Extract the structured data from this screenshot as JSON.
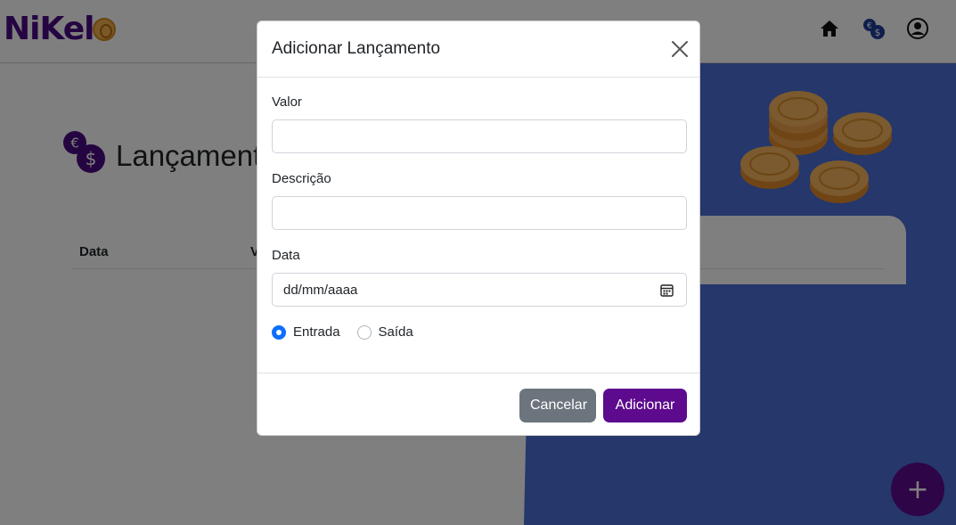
{
  "app": {
    "logo_text": "NiKel",
    "nav_icons": [
      "home-icon",
      "currency-exchange-icon",
      "user-profile-icon"
    ]
  },
  "page": {
    "title": "Lançamentos",
    "table_headers": [
      "Data",
      "Valor"
    ],
    "fab_label": "+"
  },
  "modal": {
    "title": "Adicionar Lançamento",
    "fields": {
      "valor_label": "Valor",
      "valor_value": "",
      "descricao_label": "Descrição",
      "descricao_value": "",
      "data_label": "Data",
      "data_placeholder": "dd/mm/aaaa"
    },
    "radios": [
      {
        "label": "Entrada",
        "checked": true
      },
      {
        "label": "Saída",
        "checked": false
      }
    ],
    "buttons": {
      "cancel": "Cancelar",
      "add": "Adicionar"
    }
  },
  "colors": {
    "brand_purple": "#5d0a8e",
    "blue_background": "#4a6fd6",
    "radio_checked": "#0d6efd",
    "cancel_gray": "#6c757d"
  }
}
